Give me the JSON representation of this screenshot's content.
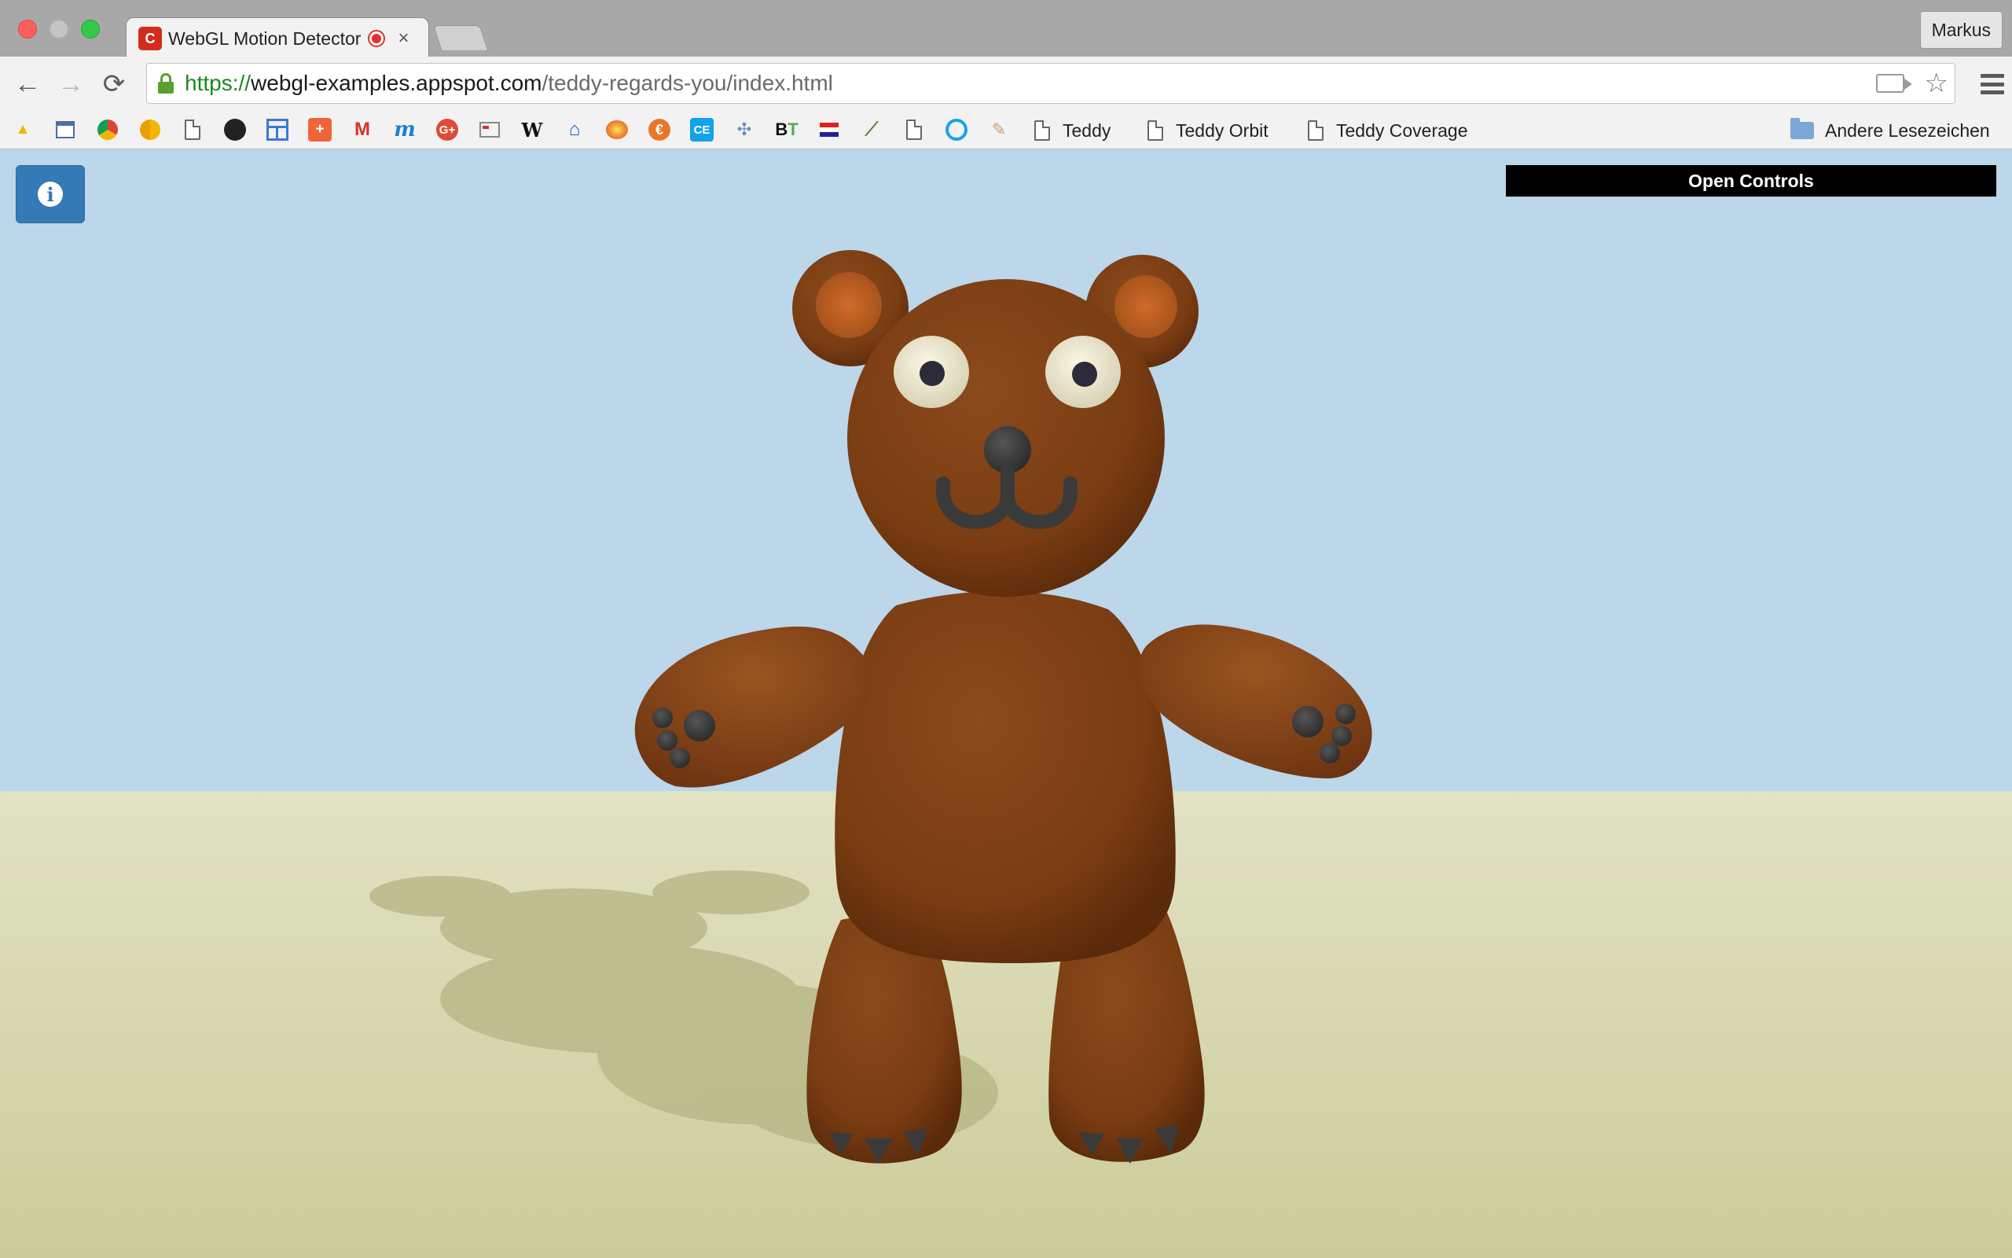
{
  "window": {
    "profile_name": "Markus"
  },
  "tab": {
    "title": "WebGL Motion Detector",
    "favicon_letter": "C",
    "close_glyph": "×"
  },
  "toolbar": {
    "back_glyph": "←",
    "forward_glyph": "→",
    "reload_glyph": "⟳",
    "url_scheme": "https://",
    "url_host": "webgl-examples.appspot.com",
    "url_path": "/teddy-regards-you/index.html",
    "star_glyph": "☆"
  },
  "bookmarks": {
    "icons": [
      "drive-icon",
      "calendar-icon",
      "chrome-icon",
      "chrome-canary-icon",
      "page-icon",
      "github-icon",
      "layout-icon",
      "plus-icon",
      "gmail-icon",
      "m-icon",
      "google-plus-icon",
      "news-icon",
      "wikipedia-icon",
      "home-icon",
      "fire-icon",
      "euro-icon",
      "ce-icon",
      "network-icon",
      "bt-icon",
      "flag-icon",
      "brush-icon",
      "page-icon",
      "circle-icon",
      "draw-icon"
    ],
    "links": [
      {
        "label": "Teddy"
      },
      {
        "label": "Teddy Orbit"
      },
      {
        "label": "Teddy Coverage"
      }
    ],
    "other_folder": "Andere Lesezeichen"
  },
  "page": {
    "info_glyph": "i",
    "controls_label": "Open Controls"
  },
  "colors": {
    "sky": "#bcd6ea",
    "ground": "#d3d3a8",
    "fur": "#7e3f15",
    "button_blue": "#337ab7"
  }
}
